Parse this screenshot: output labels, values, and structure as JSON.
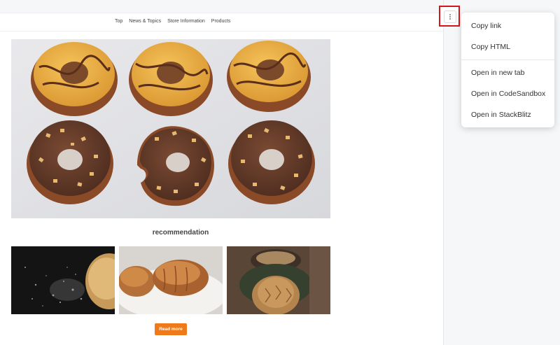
{
  "site": {
    "nav": [
      "Top",
      "News & Topics",
      "Store Information",
      "Products"
    ],
    "section_title": "recommendation",
    "read_more_label": "Read more"
  },
  "images": {
    "hero": "donuts-photo",
    "thumbnails": [
      "flour-and-bread-photo",
      "croissants-photo",
      "bread-loaf-photo"
    ]
  },
  "toolbar": {
    "menu_button_icon": "kebab-icon"
  },
  "menu": {
    "items": [
      "Copy link",
      "Copy HTML",
      "Open in new tab",
      "Open in CodeSandbox",
      "Open in StackBlitz"
    ]
  },
  "colors": {
    "accent": "#ef7a1a",
    "highlight": "#d6161d"
  }
}
